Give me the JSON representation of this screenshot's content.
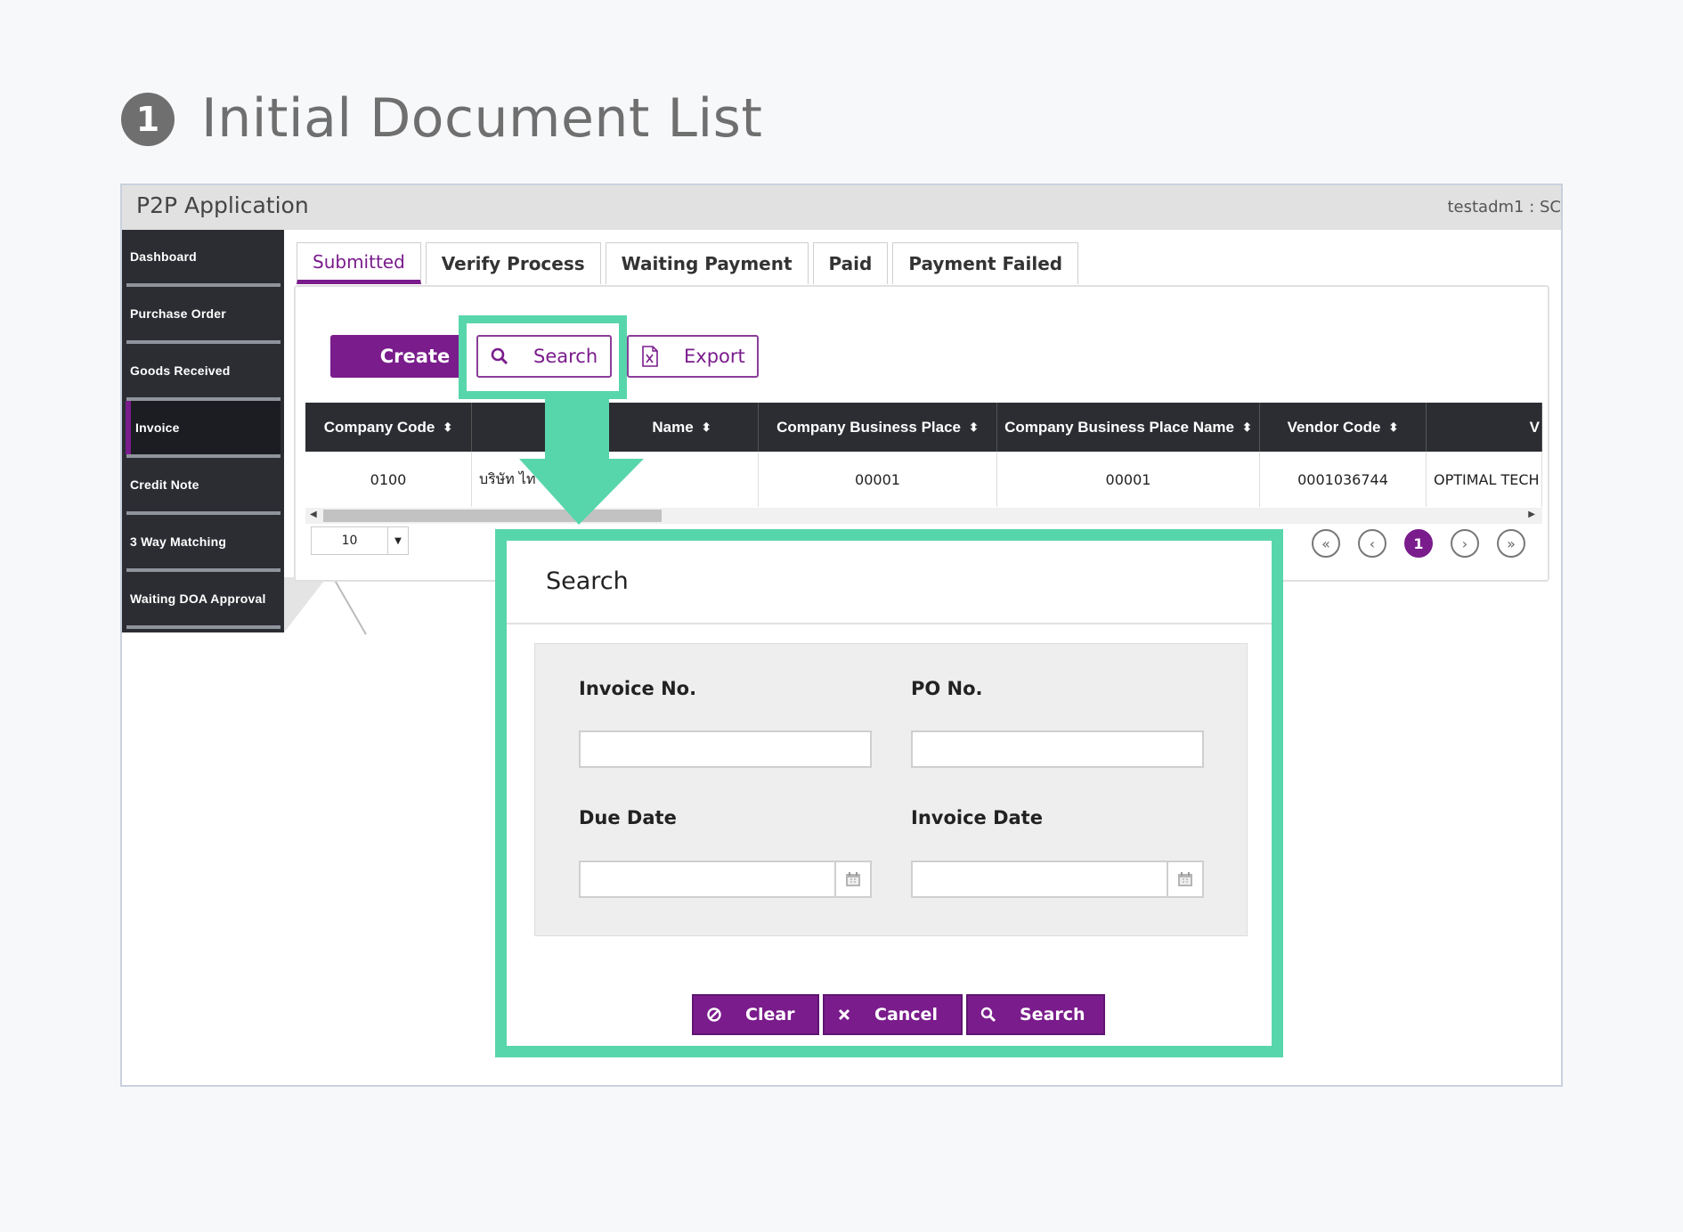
{
  "step": {
    "number": "1",
    "title": "Initial Document List"
  },
  "app": {
    "title": "P2P Application",
    "user": "testadm1 : SC"
  },
  "sidebar": {
    "items": [
      {
        "label": "Dashboard"
      },
      {
        "label": "Purchase Order"
      },
      {
        "label": "Goods Received"
      },
      {
        "label": "Invoice",
        "active": true
      },
      {
        "label": "Credit Note"
      },
      {
        "label": "3 Way Matching"
      },
      {
        "label": "Waiting DOA Approval"
      }
    ]
  },
  "tabs": [
    {
      "label": "Submitted",
      "active": true
    },
    {
      "label": "Verify Process"
    },
    {
      "label": "Waiting Payment"
    },
    {
      "label": "Paid"
    },
    {
      "label": "Payment Failed"
    }
  ],
  "toolbar": {
    "create_label": "Create",
    "search_label": "Search",
    "export_label": "Export"
  },
  "table": {
    "columns": [
      "Company Code",
      "Name",
      "Company Business Place",
      "Company Business Place Name",
      "Vendor Code",
      "V"
    ],
    "rows": [
      [
        "0100",
        "บริษัท ไท",
        "00001",
        "00001",
        "0001036744",
        "OPTIMAL TECH"
      ]
    ],
    "page_size": "10",
    "current_page": "1"
  },
  "modal": {
    "title": "Search",
    "fields": {
      "invoice_no": {
        "label": "Invoice No.",
        "value": ""
      },
      "po_no": {
        "label": "PO No.",
        "value": ""
      },
      "due_date": {
        "label": "Due Date",
        "value": ""
      },
      "invoice_date": {
        "label": "Invoice Date",
        "value": ""
      }
    },
    "buttons": {
      "clear": "Clear",
      "cancel": "Cancel",
      "search": "Search"
    }
  },
  "colors": {
    "accent": "#7a1c8c",
    "highlight": "#58d6ab",
    "sidebar": "#2b2d33"
  }
}
